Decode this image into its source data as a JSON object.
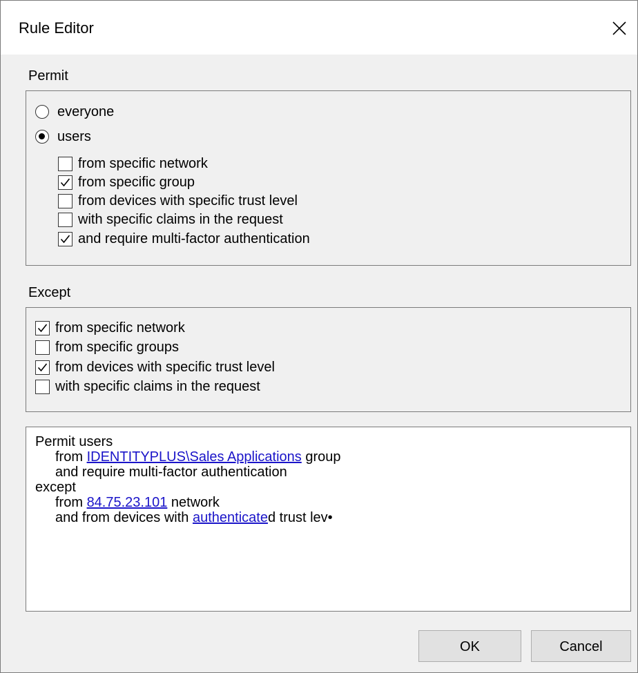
{
  "window": {
    "title": "Rule Editor",
    "close_icon": "close-icon"
  },
  "permit": {
    "label": "Permit",
    "radios": [
      {
        "label": "everyone",
        "selected": false
      },
      {
        "label": "users",
        "selected": true
      }
    ],
    "conditions": [
      {
        "label": "from specific network",
        "checked": false
      },
      {
        "label": "from specific group",
        "checked": true
      },
      {
        "label": "from devices with specific trust level",
        "checked": false
      },
      {
        "label": "with specific claims in the request",
        "checked": false
      },
      {
        "label": "and require multi-factor authentication",
        "checked": true
      }
    ]
  },
  "except": {
    "label": "Except",
    "conditions": [
      {
        "label": "from specific network",
        "checked": true
      },
      {
        "label": "from specific groups",
        "checked": false
      },
      {
        "label": "from devices with specific trust level",
        "checked": true
      },
      {
        "label": "with specific claims in the request",
        "checked": false
      }
    ]
  },
  "summary": {
    "line1": "Permit users",
    "line2_prefix": "from ",
    "line2_link": "IDENTITYPLUS\\Sales Applications",
    "line2_suffix": " group",
    "line3": "and require multi-factor authentication",
    "line4": "except",
    "line5_prefix": "from ",
    "line5_link": "84.75.23.101",
    "line5_suffix": " network",
    "line6_prefix": "and from devices with ",
    "line6_link": "authenticate",
    "line6_suffix": "d trust lev•"
  },
  "buttons": {
    "ok_label": "OK",
    "cancel_label": "Cancel"
  },
  "colors": {
    "link": "#1a14c9",
    "dialog_background": "#f0f0f0",
    "button_face": "#e1e1e1"
  }
}
